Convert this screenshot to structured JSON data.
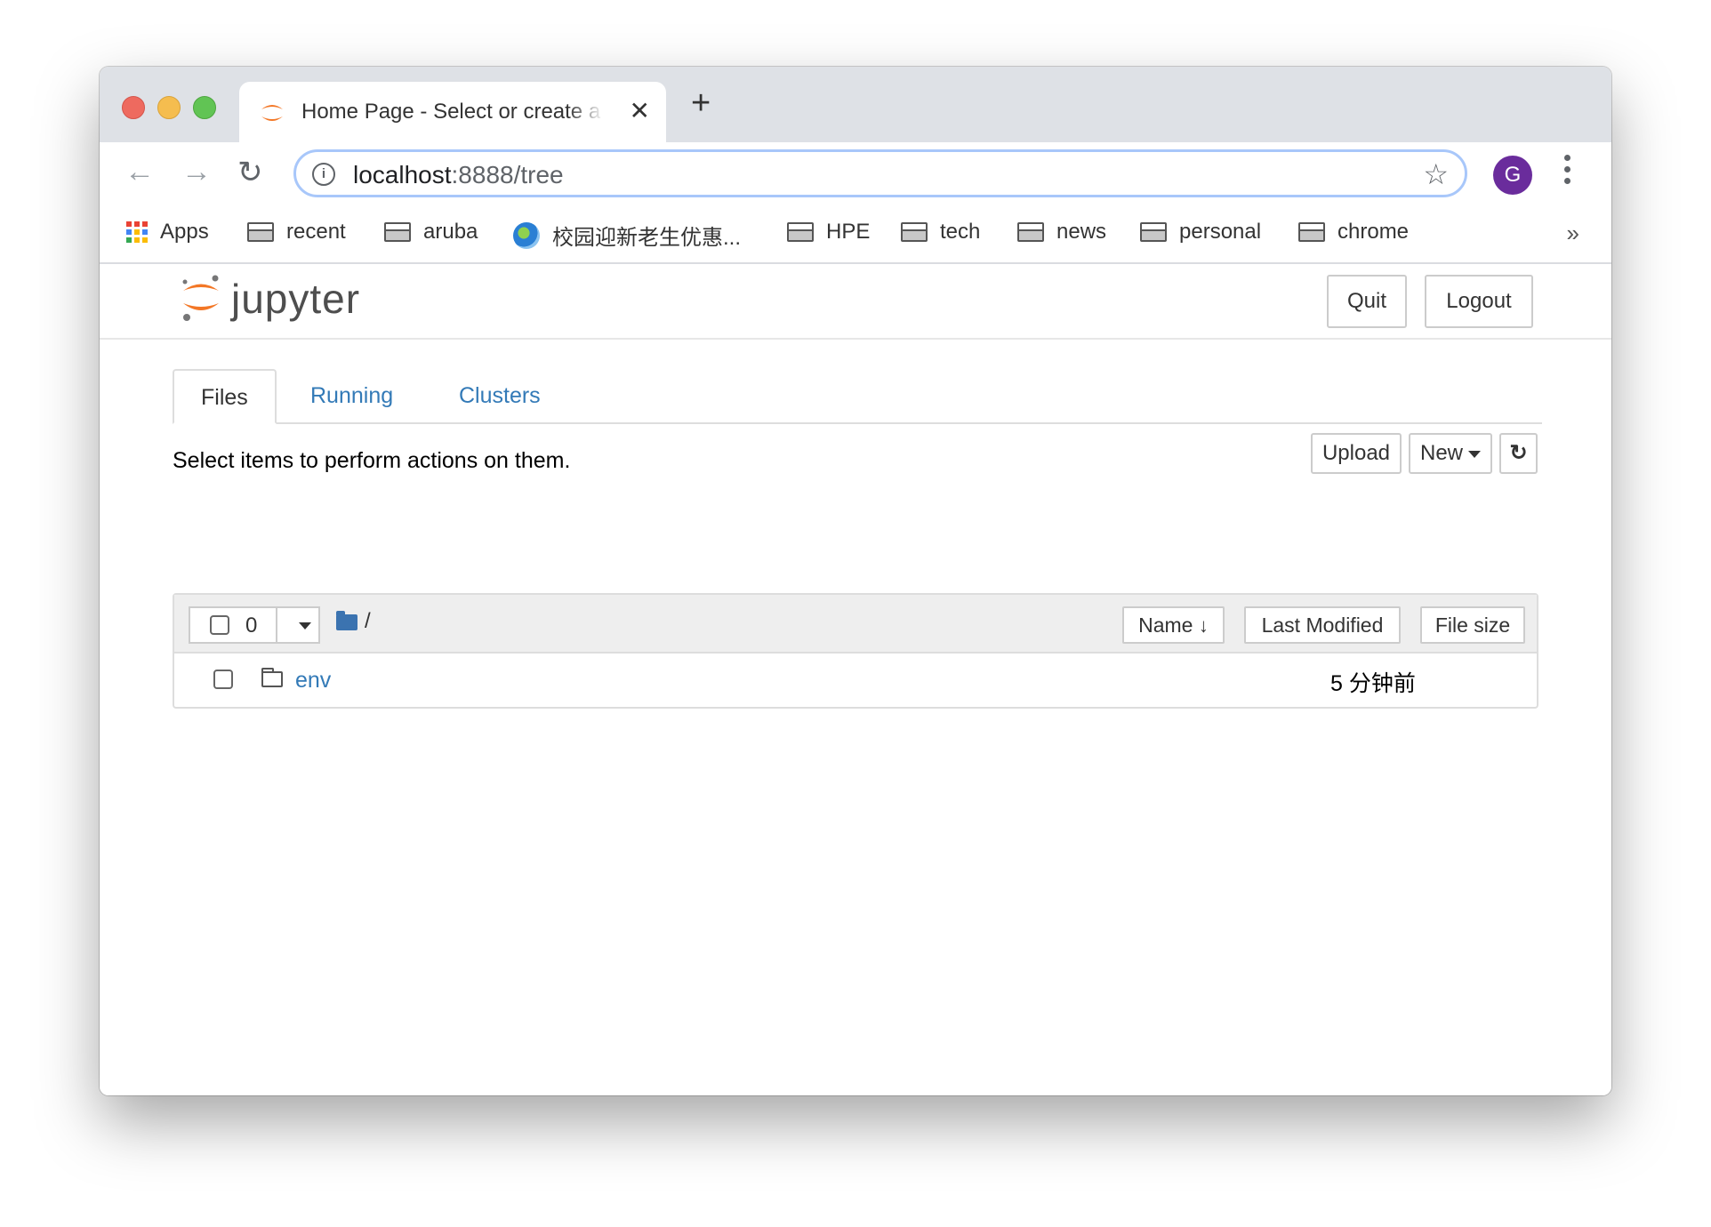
{
  "browser": {
    "tab_title": "Home Page - Select or create a notebook",
    "new_tab_icon": "plus-icon",
    "url_host": "localhost",
    "url_rest": ":8888/tree",
    "avatar_letter": "G",
    "avatar_color": "#6a2c9c",
    "bookmarks": [
      {
        "label": "Apps",
        "icon": "apps-grid-icon"
      },
      {
        "label": "recent",
        "icon": "folder-icon"
      },
      {
        "label": "aruba",
        "icon": "folder-icon"
      },
      {
        "label": "校园迎新老生优惠...",
        "icon": "globe-icon"
      },
      {
        "label": "HPE",
        "icon": "folder-icon"
      },
      {
        "label": "tech",
        "icon": "folder-icon"
      },
      {
        "label": "news",
        "icon": "folder-icon"
      },
      {
        "label": "personal",
        "icon": "folder-icon"
      },
      {
        "label": "chrome",
        "icon": "folder-icon"
      }
    ],
    "overflow_label": "»"
  },
  "jupyter": {
    "logo_text": "jupyter",
    "quit_label": "Quit",
    "logout_label": "Logout",
    "tabs": [
      {
        "label": "Files",
        "active": true
      },
      {
        "label": "Running",
        "active": false
      },
      {
        "label": "Clusters",
        "active": false
      }
    ],
    "hint": "Select items to perform actions on them.",
    "upload_label": "Upload",
    "new_label": "New",
    "refresh_icon": "↻",
    "selected_count": "0",
    "breadcrumb": "/",
    "sort_buttons": {
      "name": "Name",
      "name_arrow": "🡻",
      "last_modified": "Last Modified",
      "file_size": "File size"
    },
    "files": [
      {
        "name": "env",
        "type": "folder",
        "modified": "5 分钟前",
        "size": ""
      }
    ],
    "accent_color": "#337ab7",
    "logo_color": "#f37726"
  }
}
